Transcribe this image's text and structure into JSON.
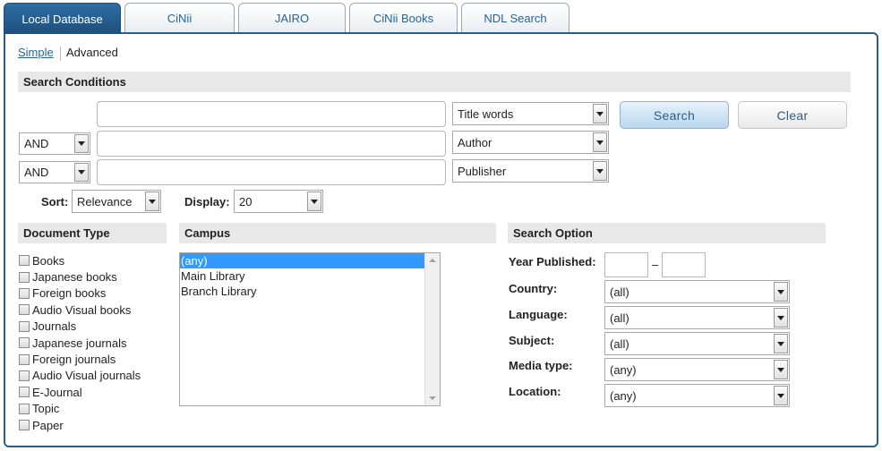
{
  "tabs": [
    "Local Database",
    "CiNii",
    "JAIRO",
    "CiNii Books",
    "NDL Search"
  ],
  "mode": {
    "simple": "Simple",
    "advanced": "Advanced"
  },
  "search_conditions": {
    "title": "Search Conditions",
    "rows": [
      {
        "operator": "",
        "value": "",
        "field": "Title words"
      },
      {
        "operator": "AND",
        "value": "",
        "field": "Author"
      },
      {
        "operator": "AND",
        "value": "",
        "field": "Publisher"
      }
    ],
    "search_label": "Search",
    "clear_label": "Clear"
  },
  "sort": {
    "label": "Sort:",
    "value": "Relevance"
  },
  "display": {
    "label": "Display:",
    "value": "20"
  },
  "document_type": {
    "title": "Document Type",
    "items": [
      "Books",
      "Japanese books",
      "Foreign books",
      "Audio Visual books",
      "Journals",
      "Japanese journals",
      "Foreign journals",
      "Audio Visual journals",
      "E-Journal",
      "Topic",
      "Paper"
    ]
  },
  "campus": {
    "title": "Campus",
    "items": [
      "(any)",
      "Main Library",
      "Branch Library"
    ],
    "selected_index": 0
  },
  "search_option": {
    "title": "Search Option",
    "year_label": "Year Published:",
    "year_from": "",
    "year_to": "",
    "year_sep": "–",
    "fields": [
      {
        "label": "Country:",
        "value": "(all)"
      },
      {
        "label": "Language:",
        "value": "(all)"
      },
      {
        "label": "Subject:",
        "value": "(all)"
      },
      {
        "label": "Media type:",
        "value": "(any)"
      },
      {
        "label": "Location:",
        "value": "(any)"
      }
    ]
  },
  "colors": {
    "accent": "#2a5d8a",
    "active_tab": "#1d4f7c",
    "link": "#2a6496",
    "selection": "#3399ff"
  }
}
